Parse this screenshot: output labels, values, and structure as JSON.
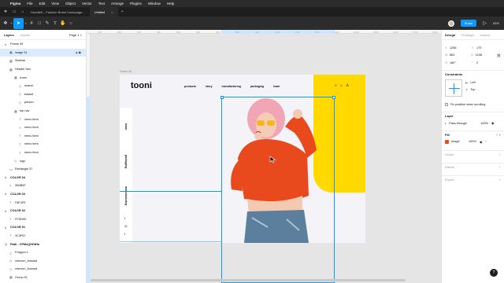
{
  "menubar": {
    "apple": "",
    "items": [
      "Figma",
      "File",
      "Edit",
      "View",
      "Object",
      "Vector",
      "Text",
      "Arrange",
      "Plugins",
      "Window",
      "Help"
    ]
  },
  "tabs": [
    {
      "label": "Hoodie8 – Fashion Brand homepage...",
      "active": false
    },
    {
      "label": "Untitled",
      "active": true
    }
  ],
  "toolbar": {
    "share_label": "Share",
    "zoom_label": "65%"
  },
  "left_panel": {
    "tab_layers": "Layers",
    "tab_assets": "Assets",
    "page_label": "Page 1 ˅",
    "layers": [
      {
        "name": "Frame 45",
        "indent": 1,
        "icon": "#",
        "bold": false,
        "selected": false
      },
      {
        "name": "image 31",
        "indent": 2,
        "icon": "▣",
        "bold": false,
        "selected": true
      },
      {
        "name": "Sidebar",
        "indent": 2,
        "icon": "▦",
        "bold": false,
        "selected": false
      },
      {
        "name": "Header Nav",
        "indent": 2,
        "icon": "▦",
        "bold": false,
        "selected": false
      },
      {
        "name": "Icons",
        "indent": 3,
        "icon": "▦",
        "bold": false,
        "selected": false
      },
      {
        "name": "search",
        "indent": 4,
        "icon": "◇",
        "bold": false,
        "selected": false
      },
      {
        "name": "basket",
        "indent": 4,
        "icon": "◇",
        "bold": false,
        "selected": false
      },
      {
        "name": "person",
        "indent": 4,
        "icon": "◇",
        "bold": false,
        "selected": false
      },
      {
        "name": "top nav",
        "indent": 3,
        "icon": "▦",
        "bold": false,
        "selected": false
      },
      {
        "name": "menu item",
        "indent": 4,
        "icon": "T",
        "bold": false,
        "selected": false
      },
      {
        "name": "menu item",
        "indent": 4,
        "icon": "T",
        "bold": false,
        "selected": false
      },
      {
        "name": "menu item",
        "indent": 4,
        "icon": "T",
        "bold": false,
        "selected": false
      },
      {
        "name": "menu item",
        "indent": 4,
        "icon": "T",
        "bold": false,
        "selected": false
      },
      {
        "name": "menu item",
        "indent": 4,
        "icon": "T",
        "bold": false,
        "selected": false
      },
      {
        "name": "logo",
        "indent": 3,
        "icon": "◇",
        "bold": false,
        "selected": false
      },
      {
        "name": "Rectangle 37",
        "indent": 2,
        "icon": "▭",
        "bold": false,
        "selected": false
      },
      {
        "name": "COLOR 04",
        "indent": 1,
        "icon": "#",
        "bold": true,
        "selected": false
      },
      {
        "name": "0B0B0F",
        "indent": 2,
        "icon": "T",
        "bold": false,
        "selected": false
      },
      {
        "name": "COLOR 03",
        "indent": 1,
        "icon": "#",
        "bold": true,
        "selected": false
      },
      {
        "name": "F8F4FE",
        "indent": 2,
        "icon": "T",
        "bold": false,
        "selected": false
      },
      {
        "name": "COLOR 02",
        "indent": 1,
        "icon": "#",
        "bold": true,
        "selected": false
      },
      {
        "name": "FFDD00",
        "indent": 2,
        "icon": "T",
        "bold": false,
        "selected": false
      },
      {
        "name": "COLOR 01",
        "indent": 1,
        "icon": "#",
        "bold": true,
        "selected": false
      },
      {
        "name": "3C3F67",
        "indent": 2,
        "icon": "T",
        "bold": false,
        "selected": false
      },
      {
        "name": "Path - CPMcQHOfHn",
        "indent": 1,
        "icon": "◇",
        "bold": true,
        "selected": false
      },
      {
        "name": "Polygon 1",
        "indent": 2,
        "icon": "△",
        "bold": false,
        "selected": false
      },
      {
        "name": "chevron_forward",
        "indent": 2,
        "icon": "◇",
        "bold": false,
        "selected": false
      },
      {
        "name": "chevron_forward",
        "indent": 2,
        "icon": "◇",
        "bold": false,
        "selected": false
      },
      {
        "name": "Group 51",
        "indent": 2,
        "icon": "▦",
        "bold": false,
        "selected": false
      }
    ]
  },
  "canvas": {
    "ruler_top": [
      "100",
      "200",
      "300",
      "400",
      "500",
      "600",
      "700",
      "800",
      "900",
      "1000",
      "1100",
      "1200",
      "1300",
      "1400",
      "1500",
      "1600",
      "1700",
      "1800"
    ],
    "frame_label": "Frame 45",
    "design": {
      "logo": "tooni",
      "nav": [
        "products",
        "story",
        "manufacturing",
        "packaging",
        "team"
      ],
      "side_labels": [
        "team",
        "packaging",
        "manufacturing"
      ],
      "social": [
        "f",
        "◎",
        "t"
      ],
      "brand_yellow": "#ffd900",
      "hoodie_color": "#e84a1e",
      "background": "#f4f4f8"
    }
  },
  "right_panel": {
    "tabs": [
      "Design",
      "Prototype",
      "Inspect"
    ],
    "x": {
      "label": "X",
      "value": "1256"
    },
    "y": {
      "label": "Y",
      "value": "170"
    },
    "w": {
      "label": "W",
      "value": "663"
    },
    "h": {
      "label": "H",
      "value": "1108"
    },
    "rotation": {
      "label": "⟲",
      "value": "180°"
    },
    "radius": {
      "label": "◜",
      "value": "0"
    },
    "constraints_title": "Constraints",
    "constraint_h": "Left",
    "constraint_v": "Top",
    "fix_scroll": "Fix position when scrolling",
    "layer_title": "Layer",
    "blend": "Pass through",
    "layer_opacity": "100%",
    "fill_title": "Fill",
    "fill_type": "Image",
    "fill_opacity": "100%",
    "stroke_title": "Stroke",
    "effects_title": "Effects",
    "export_title": "Export",
    "help": "?"
  }
}
